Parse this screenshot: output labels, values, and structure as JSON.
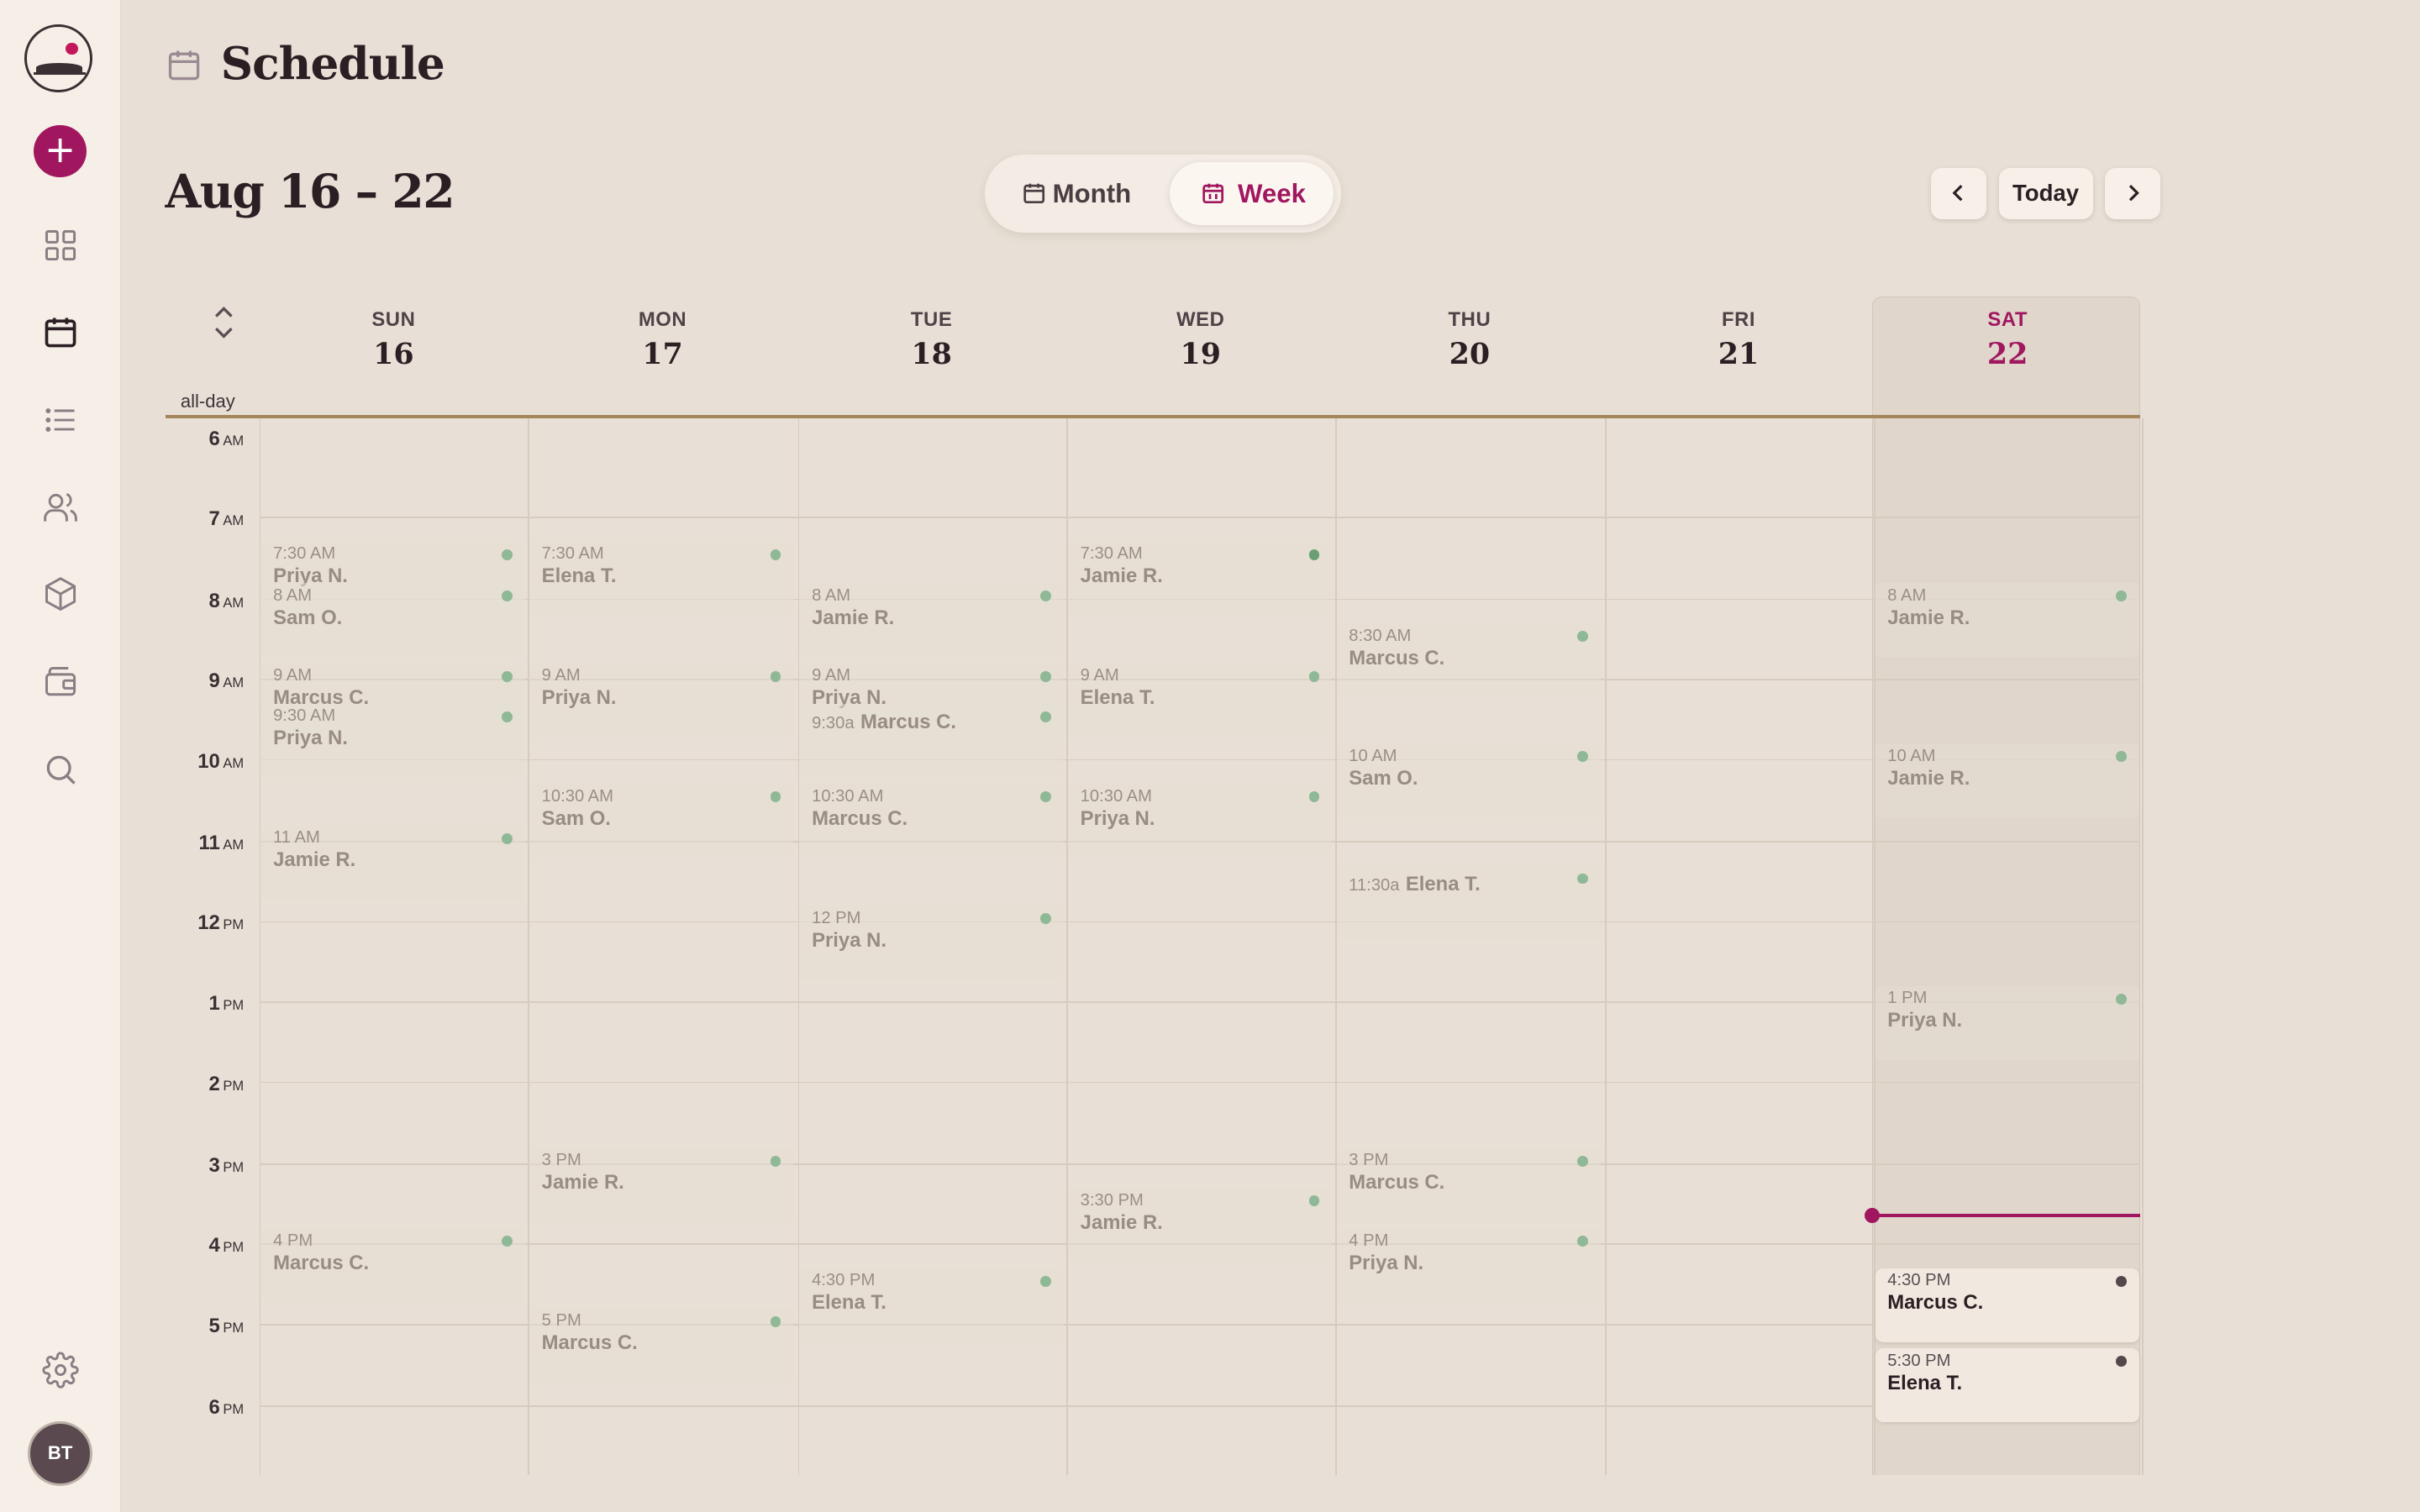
{
  "header": {
    "title": "Schedule",
    "range": "Aug 16 – 22",
    "views": {
      "month": "Month",
      "week": "Week",
      "selected": "Week"
    },
    "today_label": "Today"
  },
  "sidebar": {
    "items": [
      "dashboard",
      "schedule",
      "list",
      "people",
      "products",
      "wallet",
      "search"
    ],
    "active": "schedule",
    "avatar_initials": "BT"
  },
  "calendar": {
    "allday_label": "all-day",
    "days": [
      {
        "dow": "SUN",
        "num": "16"
      },
      {
        "dow": "MON",
        "num": "17"
      },
      {
        "dow": "TUE",
        "num": "18"
      },
      {
        "dow": "WED",
        "num": "19"
      },
      {
        "dow": "THU",
        "num": "20"
      },
      {
        "dow": "FRI",
        "num": "21"
      },
      {
        "dow": "SAT",
        "num": "22"
      }
    ],
    "today_index": 6,
    "hours": [
      {
        "h": "6",
        "ap": "AM"
      },
      {
        "h": "7",
        "ap": "AM"
      },
      {
        "h": "8",
        "ap": "AM"
      },
      {
        "h": "9",
        "ap": "AM"
      },
      {
        "h": "10",
        "ap": "AM"
      },
      {
        "h": "11",
        "ap": "AM"
      },
      {
        "h": "12",
        "ap": "PM"
      },
      {
        "h": "1",
        "ap": "PM"
      },
      {
        "h": "2",
        "ap": "PM"
      },
      {
        "h": "3",
        "ap": "PM"
      },
      {
        "h": "4",
        "ap": "PM"
      },
      {
        "h": "5",
        "ap": "PM"
      },
      {
        "h": "6",
        "ap": "PM"
      }
    ],
    "events": [
      {
        "day": 0,
        "start": 7.5,
        "time": "7:30 AM",
        "name": "Priya N."
      },
      {
        "day": 0,
        "start": 8,
        "time": "8 AM",
        "name": "Sam O."
      },
      {
        "day": 0,
        "start": 9,
        "time": "9 AM",
        "name": "Marcus C."
      },
      {
        "day": 0,
        "start": 9.5,
        "time": "9:30 AM",
        "name": "Priya N."
      },
      {
        "day": 0,
        "start": 11,
        "time": "11 AM",
        "name": "Jamie R."
      },
      {
        "day": 0,
        "start": 16,
        "time": "4 PM",
        "name": "Marcus C."
      },
      {
        "day": 1,
        "start": 7.5,
        "time": "7:30 AM",
        "name": "Elena T."
      },
      {
        "day": 1,
        "start": 9,
        "time": "9 AM",
        "name": "Priya N."
      },
      {
        "day": 1,
        "start": 10.5,
        "time": "10:30 AM",
        "name": "Sam O."
      },
      {
        "day": 1,
        "start": 15,
        "time": "3 PM",
        "name": "Jamie R."
      },
      {
        "day": 1,
        "start": 17,
        "time": "5 PM",
        "name": "Marcus C."
      },
      {
        "day": 2,
        "start": 8,
        "time": "8 AM",
        "name": "Jamie R."
      },
      {
        "day": 2,
        "start": 9,
        "time": "9 AM",
        "name": "Priya N."
      },
      {
        "day": 2,
        "start": 9.5,
        "time": "9:30a",
        "name": "Marcus C.",
        "inline": true
      },
      {
        "day": 2,
        "start": 10.5,
        "time": "10:30 AM",
        "name": "Marcus C."
      },
      {
        "day": 2,
        "start": 12,
        "time": "12 PM",
        "name": "Priya N."
      },
      {
        "day": 2,
        "start": 16.5,
        "time": "4:30 PM",
        "name": "Elena T."
      },
      {
        "day": 3,
        "start": 7.5,
        "time": "7:30 AM",
        "name": "Jamie R.",
        "darkdot": true
      },
      {
        "day": 3,
        "start": 9,
        "time": "9 AM",
        "name": "Elena T."
      },
      {
        "day": 3,
        "start": 10.5,
        "time": "10:30 AM",
        "name": "Priya N."
      },
      {
        "day": 3,
        "start": 15.5,
        "time": "3:30 PM",
        "name": "Jamie R."
      },
      {
        "day": 4,
        "start": 8.5,
        "time": "8:30 AM",
        "name": "Marcus C."
      },
      {
        "day": 4,
        "start": 10,
        "time": "10 AM",
        "name": "Sam O."
      },
      {
        "day": 4,
        "start": 11.5,
        "time": "11:30a",
        "name": "Elena T.",
        "inline": true
      },
      {
        "day": 4,
        "start": 15,
        "time": "3 PM",
        "name": "Marcus C."
      },
      {
        "day": 4,
        "start": 16,
        "time": "4 PM",
        "name": "Priya N."
      },
      {
        "day": 6,
        "start": 8,
        "time": "8 AM",
        "name": "Jamie R."
      },
      {
        "day": 6,
        "start": 10,
        "time": "10 AM",
        "name": "Jamie R."
      },
      {
        "day": 6,
        "start": 13,
        "time": "1 PM",
        "name": "Priya N."
      },
      {
        "day": 6,
        "start": 16.5,
        "time": "4:30 PM",
        "name": "Marcus C.",
        "active": true
      },
      {
        "day": 6,
        "start": 17.5,
        "time": "5:30 PM",
        "name": "Elena T.",
        "active": true
      }
    ],
    "now_hour": 15.75
  },
  "colors": {
    "accent": "#a0175f",
    "background": "#e8e0d6",
    "sidebar": "#f6efe7",
    "event_dot": "#8fb896",
    "allday_rule": "#a5855a"
  }
}
